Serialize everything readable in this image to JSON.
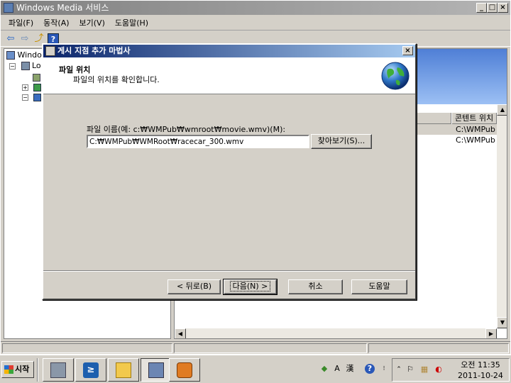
{
  "main_window": {
    "title": "Windows Media 서비스",
    "controls": {
      "minimize": "_",
      "maximize": "□",
      "close": "×"
    },
    "menu": [
      "파일(F)",
      "동작(A)",
      "보기(V)",
      "도움말(H)"
    ],
    "tree": {
      "root_label": "Windo",
      "server_label": "Lo"
    },
    "list": {
      "columns": [
        "",
        "콘텐트 위치"
      ],
      "rows": [
        {
          "col2": "C:\\WMPub"
        },
        {
          "col2": "C:\\WMPub"
        }
      ]
    }
  },
  "dialog": {
    "title": "게시 지점 추가 마법사",
    "close": "×",
    "header_title": "파일 위치",
    "header_subtitle": "파일의 위치를 확인합니다.",
    "field_label": "파일 이름(예: c:₩WMPub₩wmroot₩movie.wmv)(M):",
    "field_value": "C:₩WMPub₩WMRoot₩racecar_300.wmv",
    "browse_label": "찾아보기(S)...",
    "back_label": "< 뒤로(B)",
    "next_label": "다음(N) >",
    "cancel_label": "취소",
    "help_label": "도움말"
  },
  "taskbar": {
    "start_label": "시작",
    "ime": {
      "mode": "A",
      "hanja": "漢"
    },
    "clock_time": "오전 11:35",
    "clock_date": "2011-10-24"
  }
}
